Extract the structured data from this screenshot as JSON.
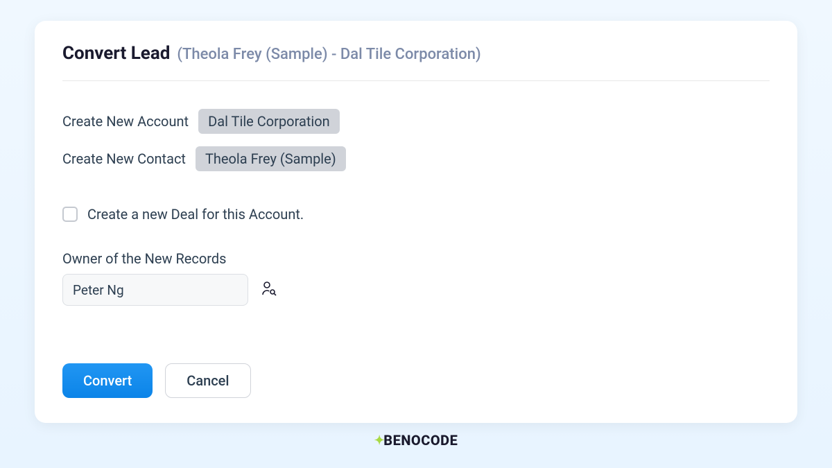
{
  "header": {
    "title": "Convert Lead",
    "subtitle": "(Theola Frey (Sample) - Dal Tile Corporation)"
  },
  "fields": {
    "account_label": "Create New Account",
    "account_value": "Dal Tile Corporation",
    "contact_label": "Create New Contact",
    "contact_value": "Theola Frey (Sample)"
  },
  "checkbox": {
    "label": "Create a new Deal for this Account.",
    "checked": false
  },
  "owner": {
    "label": "Owner of the New Records",
    "value": "Peter Ng"
  },
  "buttons": {
    "convert_label": "Convert",
    "cancel_label": "Cancel"
  },
  "footer": {
    "brand": "BENOCODE"
  }
}
